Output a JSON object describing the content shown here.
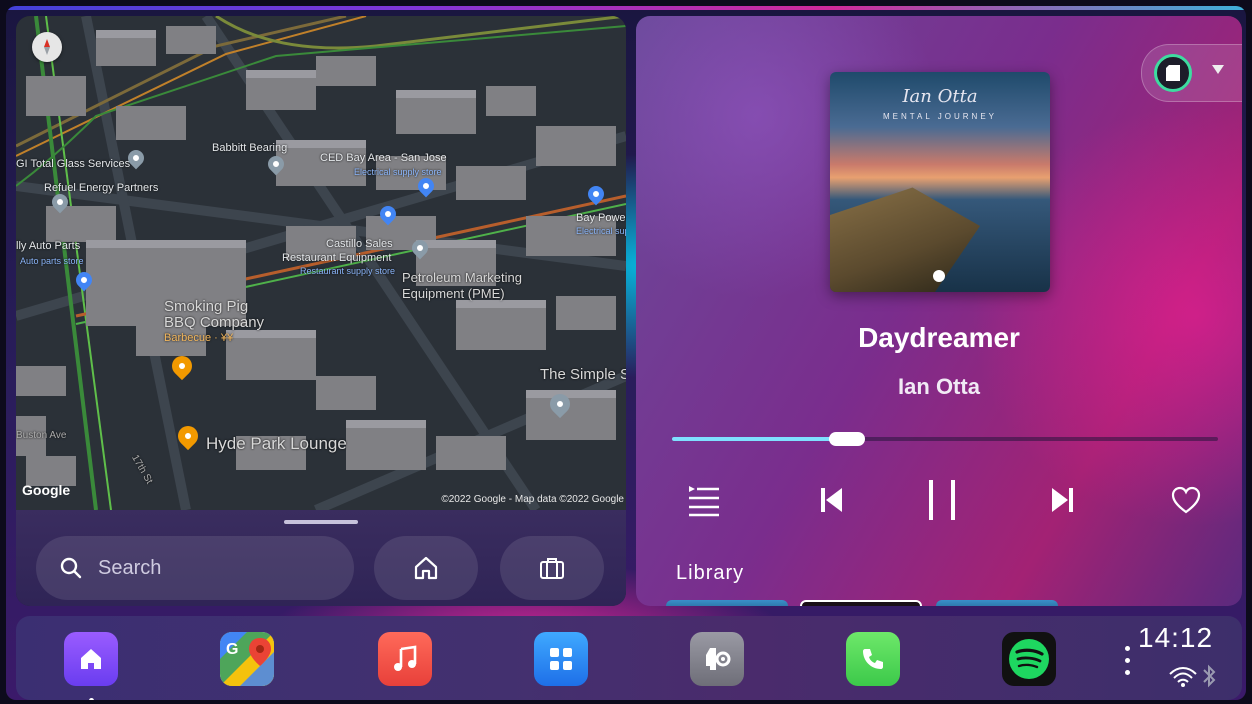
{
  "map": {
    "labels": {
      "total_glass": "GI Total Glass Services",
      "refuel": "Refuel Energy Partners",
      "babbitt": "Babbitt Bearing",
      "ced": "CED Bay Area - San Jose",
      "ced_sub": "Electrical supply store",
      "bay_power": "Bay Power",
      "bay_power_sub": "Electrical sup",
      "auto_parts": "lly Auto Parts",
      "auto_parts_sub": "Auto parts store",
      "castillo": "Castillo Sales",
      "restaurant_eq": "Restaurant Equipment",
      "restaurant_sub": "Restaurant supply store",
      "petroleum": "Petroleum Marketing",
      "petroleum2": "Equipment (PME)",
      "smoking_pig": "Smoking Pig",
      "bbq": "BBQ Company",
      "bbq_sub": "Barbecue · ¥¥",
      "simple": "The Simple S",
      "hyde_park": "Hyde Park Lounge",
      "buston": "Buston Ave",
      "st": "17th St"
    },
    "logo": "Google",
    "attribution": "©2022 Google - Map data ©2022 Google"
  },
  "search": {
    "placeholder": "Search"
  },
  "media": {
    "album_artist_script": "Ian Otta",
    "album_name": "MENTAL JOURNEY",
    "title": "Daydreamer",
    "artist": "Ian Otta",
    "progress": 0.32,
    "library_label": "Library"
  },
  "dock": {
    "apps": [
      "home-icon",
      "google-maps-icon",
      "music-icon",
      "app-grid-icon",
      "car-settings-icon",
      "phone-icon",
      "spotify-icon"
    ],
    "clock": "14:12"
  },
  "colors": {
    "progress": "#7fe0ff",
    "source_ring": "#3ddca0",
    "home_app": "#7b4dff",
    "music_app": "#f25a4a",
    "grid_app": "#2b8cff",
    "phone_app": "#4cd964",
    "spotify": "#1ed760"
  }
}
